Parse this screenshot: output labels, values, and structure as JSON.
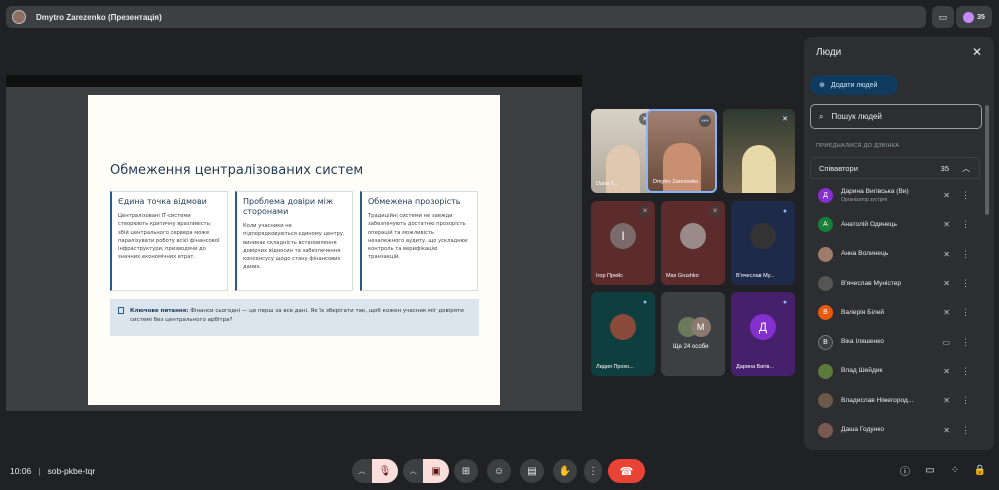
{
  "topbar": {
    "title": "Dmytro Zarezenko (Презентація)"
  },
  "top_right": {
    "people_count": "35"
  },
  "slide": {
    "title": "Обмеження централізованих систем",
    "cards": [
      {
        "heading": "Єдина точка відмови",
        "body": "Централізовані ІТ-системи створюють критичну вразливість: збій центрального сервера може паралізувати роботу всієї фінансової інфраструктури, призводячи до значних економічних втрат."
      },
      {
        "heading": "Проблема довіри між сторонами",
        "body": "Коли учасники не підпорядковуються єдиному центру, виникає складність встановлення довірчих відносин та забезпечення консенсусу щодо стану фінансових даних."
      },
      {
        "heading": "Обмежена прозорість",
        "body": "Традиційні системи не завжди забезпечують достатню прозорість операцій та можливість незалежного аудиту, що ускладнює контроль та верифікацію транзакцій."
      }
    ],
    "key_label": "Ключове питання:",
    "key_text": "Фінанси сьогодні — це перш за все дані. Як їх зберігати так, щоб кожен учасник міг довіряти системі без центрального арбітра?"
  },
  "tiles": [
    {
      "name": "Daria T..."
    },
    {
      "name": "Dmytro Zarezenko"
    },
    {
      "name": ""
    },
    {
      "name": "Ігор Прейс",
      "initial": "І"
    },
    {
      "name": "Max Grushko"
    },
    {
      "name": "В'ячеслав Му..."
    },
    {
      "name": "Лидия Прохо..."
    },
    {
      "name": "Ще 24 особи",
      "initial": "M"
    },
    {
      "name": "Дарина Вигів...",
      "initial": "Д"
    }
  ],
  "panel": {
    "title": "Люди",
    "add_label": "Додати людей",
    "search_placeholder": "Пошук людей",
    "joined_label": "ПРИЄДНАЛИСЯ ДО ДЗВІНКА",
    "group_label": "Співавтори",
    "group_count": "35",
    "people": [
      {
        "name": "Дарина Вигівська (Ви)",
        "sub": "Організатор зустрічі",
        "initial": "Д",
        "color": "#8430ce"
      },
      {
        "name": "Анатолій Одинець",
        "initial": "А",
        "color": "#188038"
      },
      {
        "name": "Анна Волинець",
        "initial": "",
        "color": "#9e7b6a"
      },
      {
        "name": "В'ячеслав Муністер",
        "initial": "",
        "color": "#555"
      },
      {
        "name": "Валерія Білей",
        "initial": "В",
        "color": "#e8590c"
      },
      {
        "name": "Віка Іляшенко",
        "initial": "В",
        "color": "#3c4043"
      },
      {
        "name": "Влад Шейдик",
        "initial": "",
        "color": "#5a7a3a"
      },
      {
        "name": "Владислав Ніжегород...",
        "initial": "",
        "color": "#6b5a4a"
      },
      {
        "name": "Даша Годунко",
        "initial": "",
        "color": "#7a5a50"
      }
    ]
  },
  "bottom": {
    "time": "10:06",
    "meeting_code": "sob-pkbe-tqr"
  }
}
